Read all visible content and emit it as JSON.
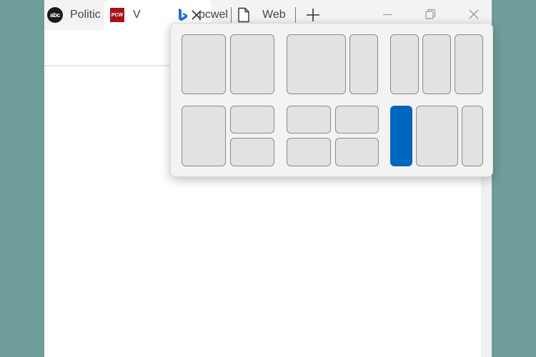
{
  "tabs": [
    {
      "label": "Politic",
      "favicon": "abc-news-icon",
      "favicon_text": "abc"
    },
    {
      "label": "V",
      "favicon": "pcworld-icon",
      "favicon_text": "PCW",
      "active": true
    },
    {
      "label": "pcwel",
      "favicon": "bing-icon"
    },
    {
      "label": "Web",
      "favicon": "document-icon"
    }
  ],
  "icons": {
    "close_tab": "close-icon",
    "new_tab": "plus-icon",
    "minimize": "minimize-icon",
    "restore": "restore-icon",
    "close_window": "close-icon"
  },
  "colors": {
    "desktop": "#6f9e9a",
    "zone_fill": "#e2e2e2",
    "zone_border": "#8a8a8a",
    "zone_selected": "#0067c0",
    "pcworld_red": "#a6141b",
    "bing_blue": "#1e6fd9"
  },
  "snap_layouts": {
    "selected_layout": 6,
    "selected_zone": 1
  }
}
